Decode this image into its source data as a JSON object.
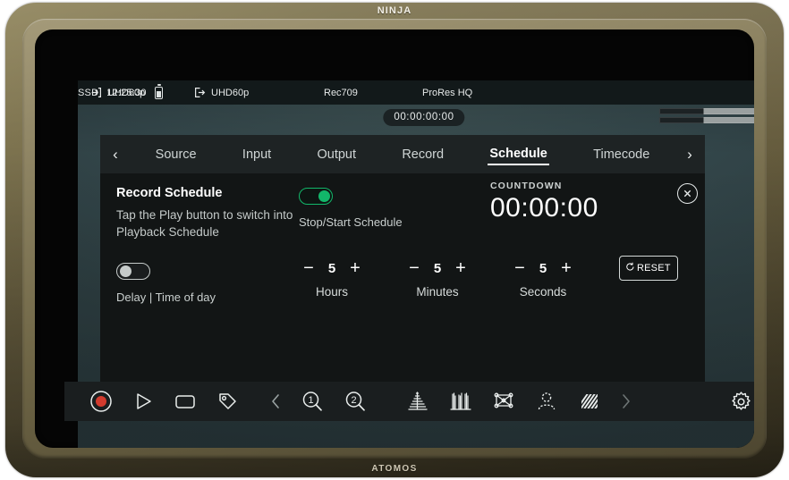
{
  "device": {
    "brand_top": "NINJA",
    "brand_bottom": "ATOMOS",
    "body_color": "#6d6343",
    "bezel_color": "#050505"
  },
  "statusbar": {
    "input": {
      "icon": "input-arrow-icon",
      "label": "UHD60p"
    },
    "output": {
      "icon": "output-arrow-icon",
      "label": "UHD60p"
    },
    "gamut": "Rec709",
    "codec": "ProRes HQ",
    "media": "SSD",
    "media_time": "12:25:30",
    "battery_icon": "battery-icon"
  },
  "timecode": "00:00:00:00",
  "meters": [
    {
      "name": "audio-meter-1",
      "level_pct": 44
    },
    {
      "name": "audio-meter-2",
      "level_pct": 44
    }
  ],
  "menu": {
    "prev_arrow": "‹",
    "next_arrow": "›",
    "tabs": [
      {
        "label": "Source",
        "active": false
      },
      {
        "label": "Input",
        "active": false
      },
      {
        "label": "Output",
        "active": false
      },
      {
        "label": "Record",
        "active": false
      },
      {
        "label": "Schedule",
        "active": true
      },
      {
        "label": "Timecode",
        "active": false
      }
    ],
    "schedule": {
      "title": "Record Schedule",
      "description": "Tap the Play button to switch into Playback Schedule",
      "stop_start": {
        "label": "Stop/Start Schedule",
        "state": "on",
        "accent": "#12b76a"
      },
      "delay": {
        "label": "Delay | Time of day",
        "state": "off"
      },
      "countdown": {
        "label": "COUNTDOWN",
        "value": "00:00:00"
      },
      "close_icon": "close-icon",
      "steppers": [
        {
          "label": "Hours",
          "value": "5",
          "minus": "−",
          "plus": "+"
        },
        {
          "label": "Minutes",
          "value": "5",
          "minus": "−",
          "plus": "+"
        },
        {
          "label": "Seconds",
          "value": "5",
          "minus": "−",
          "plus": "+"
        }
      ],
      "reset": {
        "label": "RESET",
        "icon": "refresh-icon"
      }
    }
  },
  "toolbar": {
    "record_icon": "record-icon",
    "play_icon": "play-icon",
    "stop_icon": "stop-icon",
    "tag_icon": "tag-icon",
    "prev_icon": "chevron-left-icon",
    "zoom1_icon": "magnifier-1-icon",
    "zoom2_icon": "magnifier-2-icon",
    "waveform_icon": "waveform-icon",
    "parade_icon": "rgb-parade-icon",
    "vectorscope_icon": "vectorscope-icon",
    "focus_icon": "focus-peaking-icon",
    "zebra_icon": "zebra-icon",
    "next_icon": "chevron-right-icon",
    "settings_icon": "gear-icon",
    "zoom1_label": "1",
    "zoom2_label": "2"
  }
}
